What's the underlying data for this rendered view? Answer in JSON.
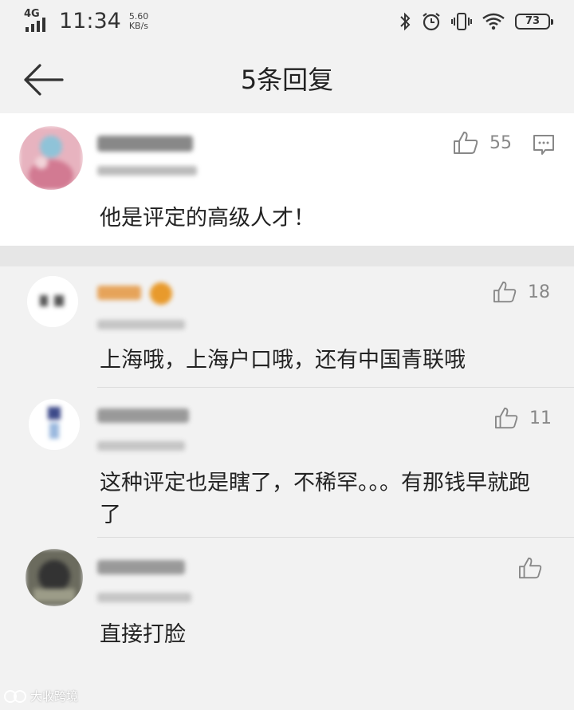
{
  "status_bar": {
    "network": "4G",
    "time": "11:34",
    "speed_value": "5.60",
    "speed_unit": "KB/s",
    "battery": "73"
  },
  "header": {
    "title": "5条回复"
  },
  "main_comment": {
    "likes": "55",
    "text": "他是评定的高级人才！"
  },
  "replies": [
    {
      "likes": "18",
      "text": "上海哦，上海户口哦，还有中国青联哦"
    },
    {
      "likes": "11",
      "text": "这种评定也是瞎了，不稀罕。。。有那钱早就跑了"
    },
    {
      "likes": "",
      "text": "直接打脸"
    }
  ],
  "watermark": "大收跨境",
  "colors": {
    "background": "#f2f2f2",
    "main_comment_bg": "#ffffff",
    "text": "#222222",
    "muted": "#888888"
  }
}
